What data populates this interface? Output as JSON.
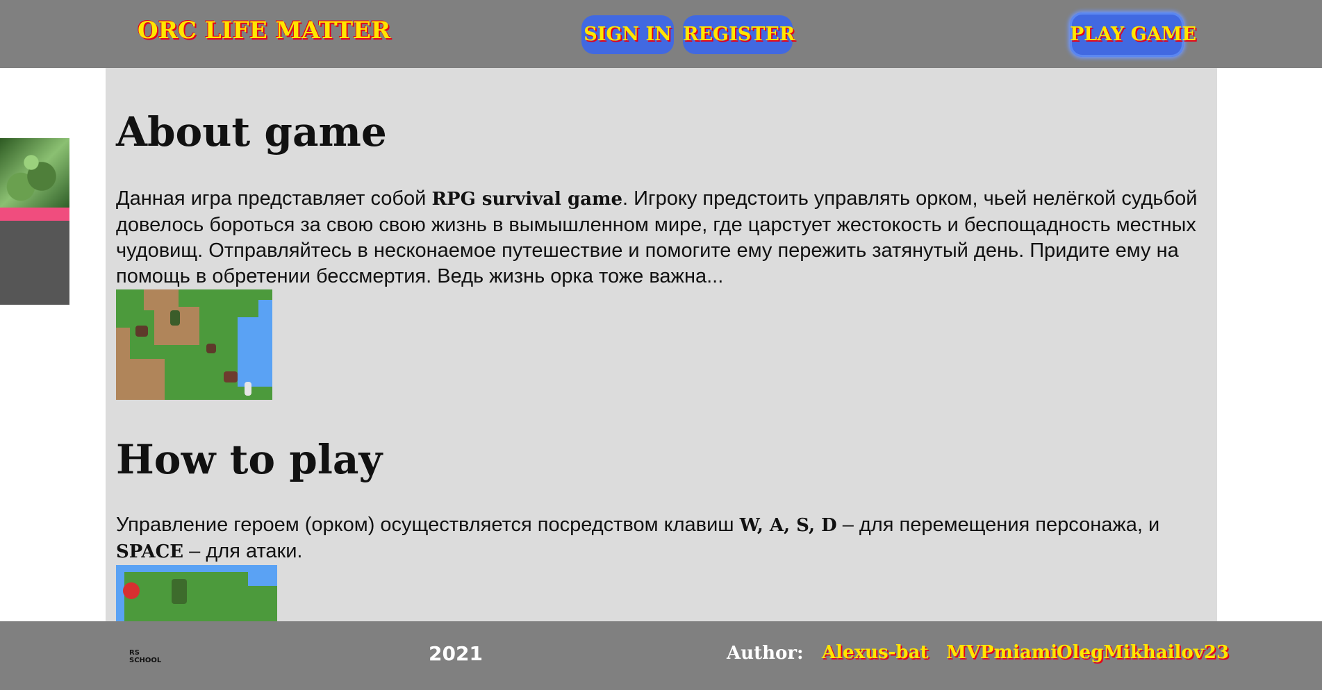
{
  "header": {
    "logo": "ORC LIFE MATTER",
    "sign_in": "SIGN IN",
    "register": "REGISTER",
    "play_game": "PLAY GAME"
  },
  "about": {
    "title": "About game",
    "text_before": "Данная игра представляет собой ",
    "highlight": "RPG survival game",
    "text_after": ". Игроку предстоить управлять орком, чьей нелёгкой судьбой довелось бороться за свою свою жизнь в вымышленном мире, где царстует жестокость и беспощадность местных чудовищ. Отправляйтесь в несконаемое путешествие и помогите ему пережить затянутый день. Придите ему на помощь в обретении бессмертия. Ведь жизнь орка тоже важна..."
  },
  "how_to_play": {
    "title": "How to play",
    "text_before": "Управление героем (орком) осуществляется посредством клавиш ",
    "keys_move": "W, A, S, D",
    "text_middle": " – для перемещения персонажа, и ",
    "keys_attack": "SPACE",
    "text_after": " – для атаки."
  },
  "footer": {
    "school_logo": "RS SCHOOL",
    "year": "2021",
    "author_label": "Author:",
    "authors": [
      "Alexus-bat",
      "MVPmiami",
      "OlegMikhailov23"
    ]
  },
  "colors": {
    "header_bg": "#808080",
    "main_bg": "#dcdcdc",
    "button_bg": "#4169e1",
    "accent_yellow": "#ffe600",
    "accent_red": "#e3001b",
    "sidebar_pink": "#f04d7e"
  }
}
